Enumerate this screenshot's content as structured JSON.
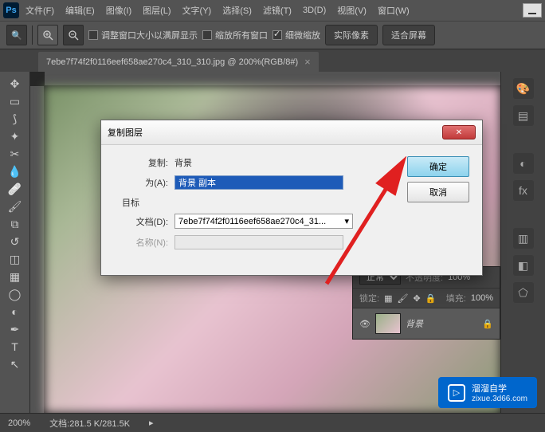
{
  "app": {
    "logo": "Ps"
  },
  "menu": {
    "file": "文件(F)",
    "edit": "编辑(E)",
    "image": "图像(I)",
    "layer": "图层(L)",
    "type": "文字(Y)",
    "select": "选择(S)",
    "filter": "滤镜(T)",
    "threeD": "3D(D)",
    "view": "视图(V)",
    "window": "窗口(W)"
  },
  "options": {
    "fit_window": "调整窗口大小以满屏显示",
    "zoom_all": "缩放所有窗口",
    "scrubby": "细微缩放",
    "actual": "实际像素",
    "fit_screen": "适合屏幕"
  },
  "tab": {
    "title": "7ebe7f74f2f0116eef658ae270c4_310_310.jpg @ 200%(RGB/8#)",
    "close": "×"
  },
  "dialog": {
    "title": "复制图层",
    "copy_label": "复制:",
    "copy_value": "背景",
    "as_label": "为(A):",
    "as_value": "背景 副本",
    "dest_label": "目标",
    "doc_label": "文档(D):",
    "doc_value": "7ebe7f74f2f0116eef658ae270c4_31...",
    "name_label": "名称(N):",
    "name_value": "",
    "ok": "确定",
    "cancel": "取消",
    "close_x": "✕"
  },
  "layers": {
    "blend": "正常",
    "opacity_label": "不透明度:",
    "opacity_value": "100%",
    "lock_label": "锁定:",
    "fill_label": "填充:",
    "fill_value": "100%",
    "layer_name": "背景"
  },
  "status": {
    "zoom": "200%",
    "doc_info": "文档:281.5 K/281.5K"
  },
  "watermark": {
    "title": "溜溜自学",
    "url": "zixue.3d66.com"
  },
  "dropdown_arrow": "▾",
  "select_arrow": "▸"
}
